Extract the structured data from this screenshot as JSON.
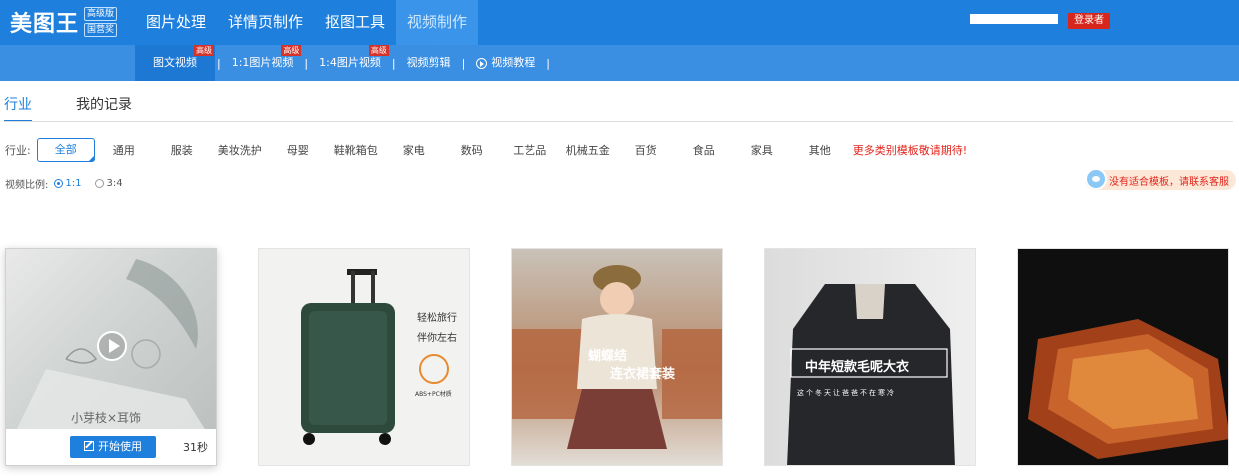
{
  "brand": {
    "logo_text": "美图王",
    "tags": [
      "高级版",
      "国营奖"
    ]
  },
  "topnav": [
    {
      "label": "图片处理",
      "active": false
    },
    {
      "label": "详情页制作",
      "active": false
    },
    {
      "label": "抠图工具",
      "active": false
    },
    {
      "label": "视频制作",
      "active": true
    }
  ],
  "user": {
    "logout_label": "登录者"
  },
  "subnav": [
    {
      "label": "图文视频",
      "badge": "高级",
      "active": true
    },
    {
      "label": "1:1图片视频",
      "badge": "高级"
    },
    {
      "label": "1:4图片视频",
      "badge": "高级"
    },
    {
      "label": "视频剪辑"
    },
    {
      "label": "视频教程"
    }
  ],
  "tabs": [
    {
      "label": "行业",
      "active": true
    },
    {
      "label": "我的记录",
      "active": false
    }
  ],
  "filters": {
    "label": "行业:",
    "options": [
      "全部",
      "通用",
      "服装",
      "美妆洗护",
      "母婴",
      "鞋靴箱包",
      "家电",
      "数码",
      "工艺品",
      "机械五金",
      "百货",
      "食品",
      "家具",
      "其他"
    ],
    "selected": "全部",
    "promo": "更多类别模板敬请期待!"
  },
  "ratio": {
    "label": "视频比例:",
    "options": [
      "1:1",
      "3:4"
    ],
    "selected": "1:1"
  },
  "suggest": {
    "text": "没有适合模板，请联系客服"
  },
  "cards": [
    {
      "overlay": "小芽枝×耳饰",
      "button": "开始使用",
      "duration": "31秒"
    },
    {
      "overlay_lines": [
        "轻松旅行",
        "伴你左右"
      ],
      "tag": "ABS+PC材质"
    },
    {
      "overlay_lines": [
        "蝴蝶结",
        "连衣裙套装"
      ]
    },
    {
      "overlay_lines": [
        "中年短款毛呢大衣",
        "这个冬天让爸爸不在寒冷"
      ]
    },
    {}
  ],
  "colors": {
    "primary": "#1e7fdc",
    "subbar": "#3b8fe2",
    "alert": "#e2231a"
  }
}
